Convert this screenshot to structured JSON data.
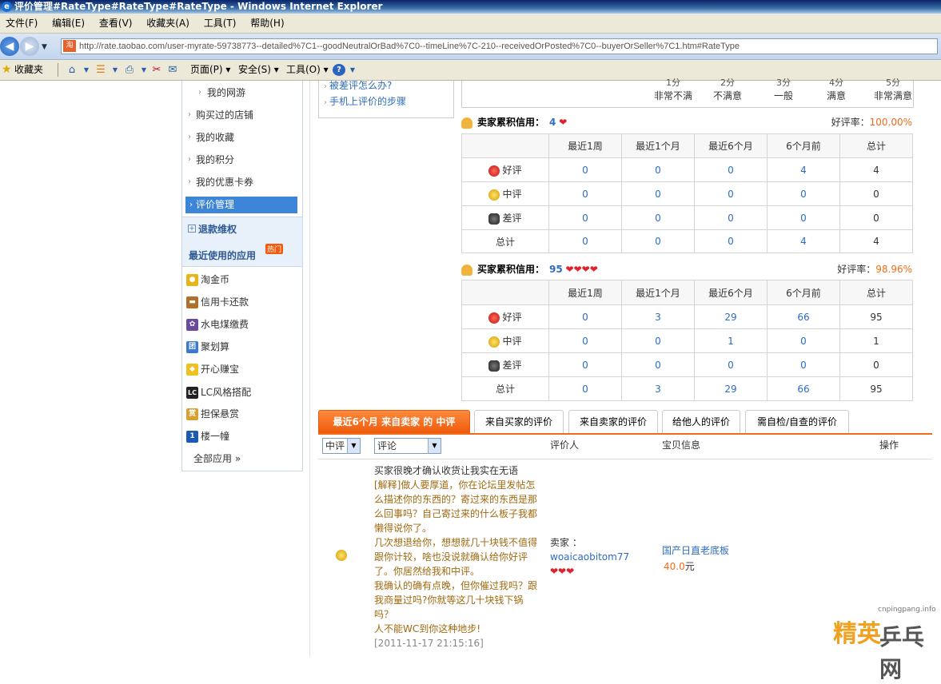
{
  "window": {
    "title": "评价管理#RateType#RateType#RateType - Windows Internet Explorer"
  },
  "menubar": [
    "文件(F)",
    "编辑(E)",
    "查看(V)",
    "收藏夹(A)",
    "工具(T)",
    "帮助(H)"
  ],
  "address": {
    "url": "http://rate.taobao.com/user-myrate-59738773--detailed%7C1--goodNeutralOrBad%7C0--timeLine%7C-210--receivedOrPosted%7C0--buyerOrSeller%7C1.htm#RateType"
  },
  "commandbar": {
    "favorites": "收藏夹",
    "page": "页面(P)",
    "safety": "安全(S)",
    "tools": "工具(O)"
  },
  "sidebar": {
    "items": [
      "我的网游",
      "购买过的店铺",
      "我的收藏",
      "我的积分",
      "我的优惠卡券"
    ],
    "active": "评价管理",
    "section": "退款维权",
    "recent_title": "最近使用的应用",
    "hot_badge": "热门",
    "apps": [
      "淘金币",
      "信用卡还款",
      "水电煤缴费",
      "聚划算",
      "开心赚宝",
      "LC风格搭配",
      "担保悬赏",
      "楼一幢"
    ],
    "all_apps": "全部应用 »"
  },
  "help": {
    "links": [
      "被差评怎么办?",
      "手机上评价的步骤"
    ]
  },
  "scale": {
    "levels": [
      "1分",
      "2分",
      "3分",
      "4分",
      "5分"
    ],
    "labels": [
      "非常不满",
      "不满意",
      "一般",
      "满意",
      "非常满意"
    ]
  },
  "seller_credit": {
    "title": "卖家累积信用：",
    "value": "4",
    "good_rate_label": "好评率：",
    "good_rate": "100.00%",
    "headers": [
      "",
      "最近1周",
      "最近1个月",
      "最近6个月",
      "6个月前",
      "总计"
    ],
    "rows": [
      {
        "label": "好评",
        "values": [
          "0",
          "0",
          "0",
          "4",
          "4"
        ]
      },
      {
        "label": "中评",
        "values": [
          "0",
          "0",
          "0",
          "0",
          "0"
        ]
      },
      {
        "label": "差评",
        "values": [
          "0",
          "0",
          "0",
          "0",
          "0"
        ]
      },
      {
        "label": "总计",
        "values": [
          "0",
          "0",
          "0",
          "4",
          "4"
        ]
      }
    ]
  },
  "buyer_credit": {
    "title": "买家累积信用：",
    "value": "95",
    "good_rate_label": "好评率：",
    "good_rate": "98.96%",
    "headers": [
      "",
      "最近1周",
      "最近1个月",
      "最近6个月",
      "6个月前",
      "总计"
    ],
    "rows": [
      {
        "label": "好评",
        "values": [
          "0",
          "3",
          "29",
          "66",
          "95"
        ]
      },
      {
        "label": "中评",
        "values": [
          "0",
          "0",
          "1",
          "0",
          "1"
        ]
      },
      {
        "label": "差评",
        "values": [
          "0",
          "0",
          "0",
          "0",
          "0"
        ]
      },
      {
        "label": "总计",
        "values": [
          "0",
          "3",
          "29",
          "66",
          "95"
        ]
      }
    ]
  },
  "tabs": [
    "最近6个月 来自卖家 的 中评",
    "来自买家的评价",
    "来自卖家的评价",
    "给他人的评价",
    "需自检/自查的评价"
  ],
  "list_header": {
    "filter1": "中评",
    "filter2": "评论",
    "col_rater": "评价人",
    "col_item": "宝贝信息",
    "col_action": "操作"
  },
  "comment": {
    "main": "买家很晚才确认收货让我实在无语",
    "explain": "[解释]做人要厚道，你在论坛里发帖怎么描述你的东西的？寄过来的东西是那么回事吗？自己寄过来的什么板子我都懒得说你了。",
    "more1": "几次想退给你，想想就几十块钱不值得跟你计较，啥也没说就确认给你好评了。你居然给我和中评。",
    "more2": "我确认的确有点晚，但你催过我吗？跟我商量过吗?你就等这几十块钱下锅吗？",
    "more3": "人不能WC到你这种地步!",
    "time": "[2011-11-17 21:15:16]",
    "rater_role": "卖家 ：",
    "rater_name": "woaicaobitom77",
    "item_name": "国产日直老底板",
    "price": "40.0",
    "price_unit": "元"
  },
  "watermark": {
    "site": "cnpingpang.info",
    "logo_a": "精英",
    "logo_b": "乒乓网"
  }
}
